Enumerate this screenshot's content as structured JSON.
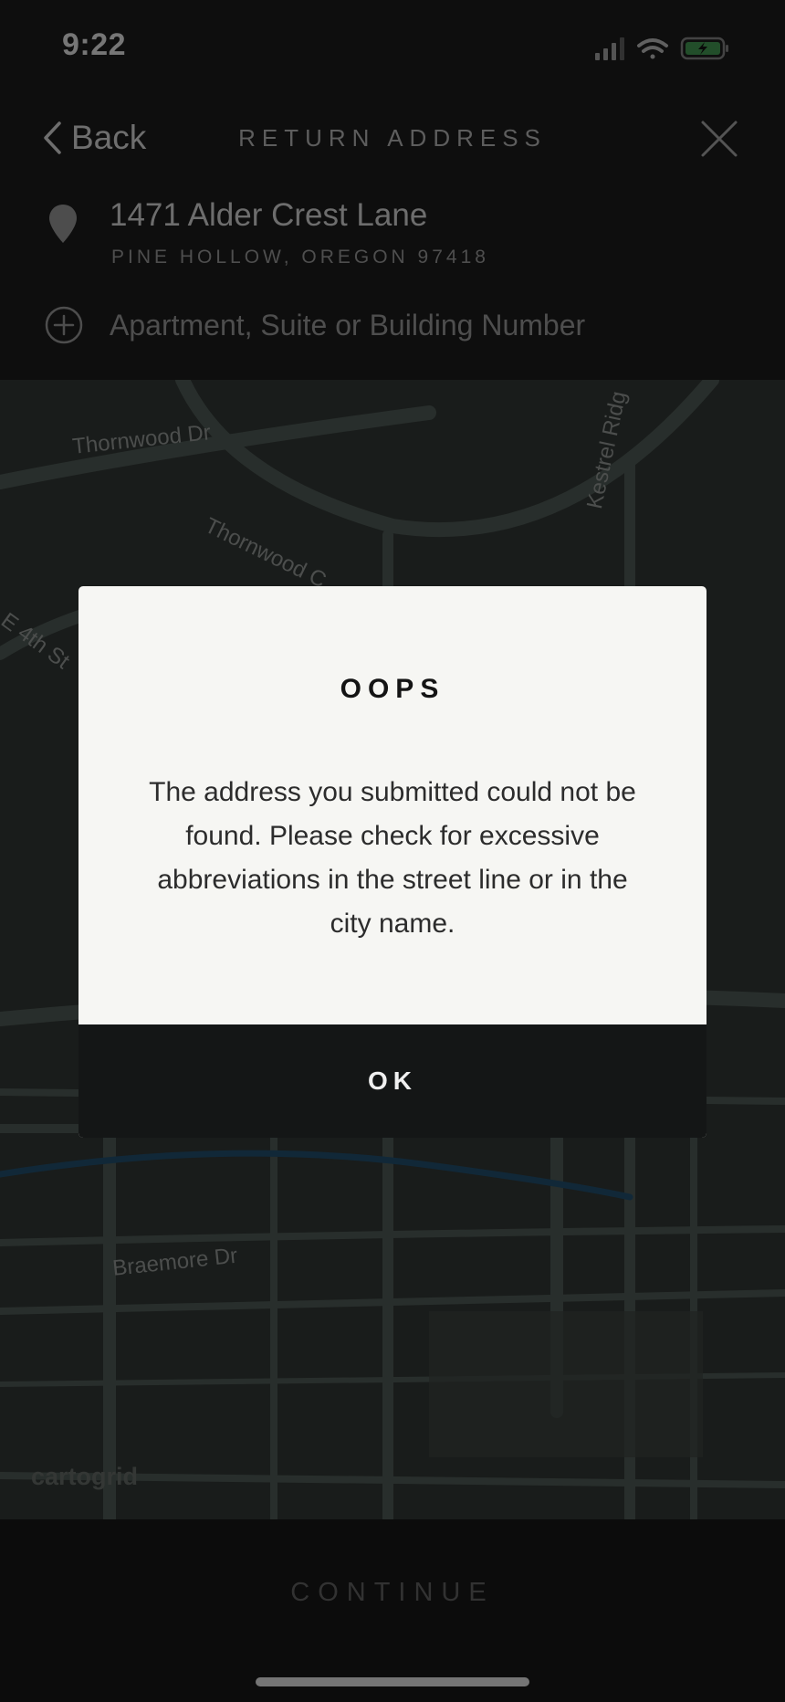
{
  "status_bar": {
    "time": "9:22",
    "icons": [
      "cellular-signal-icon",
      "wifi-icon",
      "battery-charging-icon"
    ],
    "battery_color": "#3e8e4e"
  },
  "header": {
    "back_label": "Back",
    "title": "RETURN ADDRESS",
    "close_icon": "close-icon"
  },
  "address": {
    "street": "1471 Alder Crest Lane",
    "city_line": "PINE HOLLOW, OREGON 97418",
    "icon": "location-pin-icon"
  },
  "apartment": {
    "placeholder": "Apartment, Suite or Building Number",
    "value": "",
    "icon": "add-circle-icon"
  },
  "map": {
    "street_labels": [
      "Thornwood Dr",
      "Thornwood C",
      "Kestrel Ridg",
      "E 4th St",
      "Braemore Dr"
    ],
    "attribution": "cartogrid",
    "road_color": "#4f5a55",
    "water_color": "#1f4a66"
  },
  "dialog": {
    "title": "OOPS",
    "message": "The address you submitted could not be found. Please check for excessive abbreviations in the street line or in the city name.",
    "ok_label": "OK"
  },
  "footer": {
    "continue_label": "CONTINUE"
  }
}
